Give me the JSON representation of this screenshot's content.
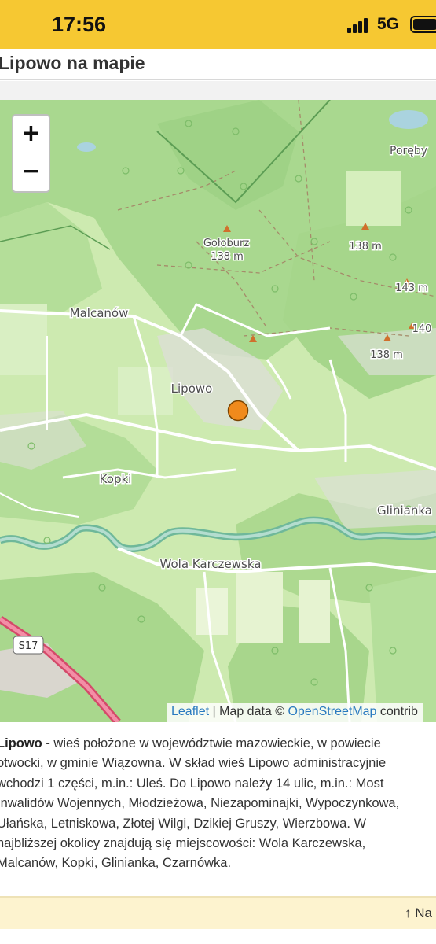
{
  "status_bar": {
    "time": "17:56",
    "network": "5G",
    "background_color": "#f6c832"
  },
  "header": {
    "title": "Lipowo na mapie"
  },
  "map": {
    "zoom_in_label": "+",
    "zoom_out_label": "−",
    "labels": {
      "goloburz": "Gołoburz",
      "goloburz_elev": "138 m",
      "elev_138_a": "138 m",
      "elev_143": "143 m",
      "elev_140": "140",
      "elev_138_b": "138 m",
      "poreby": "Poręby",
      "malcanow": "Malcanów",
      "lipowo": "Lipowo",
      "kopki": "Kopki",
      "glinianka": "Glinianka",
      "wola_karczewska": "Wola Karczewska",
      "road_s17": "S17"
    },
    "attribution": {
      "leaflet": "Leaflet",
      "separator": " | Map data © ",
      "osm": "OpenStreetMap",
      "trailing": " contrib"
    },
    "marker_color": "#f08a1c"
  },
  "description": {
    "bold_name": "Lipowo",
    "lines": [
      " - wieś położone w województwie mazowieckie, w powiecie",
      "otwocki, w gminie Wiązowna. W skład wieś Lipowo administracyjnie",
      "wchodzi 1 części, m.in.: Uleś. Do Lipowo należy 14 ulic, m.in.: Most",
      "Inwalidów Wojennych, Młodzieżowa, Niezapominajki, Wypoczynkowa,",
      "Ułańska, Letniskowa, Złotej Wilgi, Dzikiej Gruszy, Wierzbowa. W",
      "najbliższej okolicy znajdują się miejscowości: Wola Karczewska,",
      "Malcanów, Kopki, Glinianka, Czarnówka."
    ]
  },
  "footer": {
    "link_label": "↑ Na"
  }
}
